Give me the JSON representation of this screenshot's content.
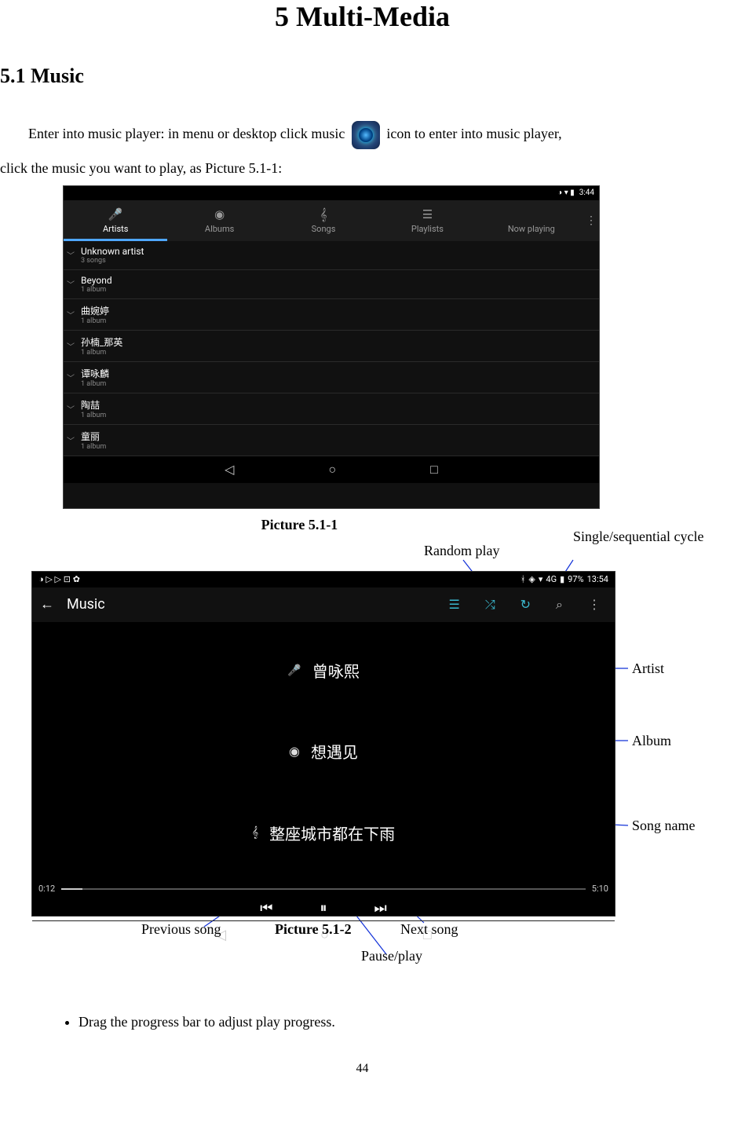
{
  "heading": "5 Multi-Media",
  "section": "5.1   Music",
  "paragraph_part1": "Enter into music player: in menu or desktop click music ",
  "paragraph_part2": "icon to enter into music player,",
  "paragraph_line2": "click the music you want to play, as Picture 5.1-1:",
  "shot1": {
    "status_time": "3:44",
    "tabs": {
      "artists": "Artists",
      "albums": "Albums",
      "songs": "Songs",
      "playlists": "Playlists",
      "nowplaying": "Now playing"
    },
    "artists": [
      {
        "name": "Unknown artist",
        "sub": "3 songs"
      },
      {
        "name": "Beyond",
        "sub": "1 album"
      },
      {
        "name": "曲婉婷",
        "sub": "1 album"
      },
      {
        "name": "孙楠_那英",
        "sub": "1 album"
      },
      {
        "name": "谭咏麟",
        "sub": "1 album"
      },
      {
        "name": "陶喆",
        "sub": "1 album"
      },
      {
        "name": "童丽",
        "sub": "1 album"
      }
    ]
  },
  "caption1": "Picture 5.1-1",
  "ann_random": "Random play",
  "ann_cycle": "Single/sequential cycle",
  "ann_artist": "Artist",
  "ann_album": "Album",
  "ann_songname": "Song name",
  "ann_prev": "Previous song",
  "ann_next": "Next song",
  "ann_pause": "Pause/play",
  "caption2": "Picture 5.1-2",
  "shot2": {
    "title": "Music",
    "battery": "97%",
    "time": "13:54",
    "signal": "4G",
    "artist": "曾咏熙",
    "album": "想遇见",
    "song": "整座城市都在下雨",
    "elapsed": "0:12",
    "total": "5:10"
  },
  "bullet1": "Drag the progress bar to adjust play progress.",
  "pagenum": "44"
}
